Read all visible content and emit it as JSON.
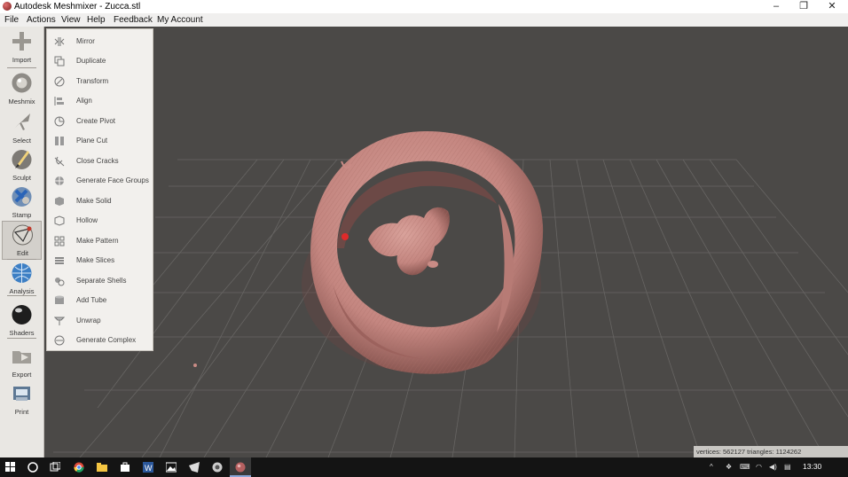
{
  "window": {
    "title": "Autodesk Meshmixer - Zucca.stl",
    "minimize_glyph": "–",
    "restore_glyph": "❐",
    "close_glyph": "✕"
  },
  "menubar": [
    "File",
    "Actions",
    "View",
    "Help",
    "Feedback",
    "My Account"
  ],
  "toolbar": [
    {
      "label": "Import",
      "icon": "plus-icon"
    },
    {
      "label": "Meshmix",
      "icon": "meshmix-sphere-icon"
    },
    {
      "label": "Select",
      "icon": "arrow-cursor-icon"
    },
    {
      "label": "Sculpt",
      "icon": "brush-icon"
    },
    {
      "label": "Stamp",
      "icon": "stamp-icon"
    },
    {
      "label": "Edit",
      "icon": "edit-sphere-icon",
      "active": true
    },
    {
      "label": "Analysis",
      "icon": "analysis-globe-icon"
    },
    {
      "label": "Shaders",
      "icon": "shader-ball-icon"
    },
    {
      "label": "Export",
      "icon": "export-folder-icon"
    },
    {
      "label": "Print",
      "icon": "printer-icon"
    }
  ],
  "edit_menu": [
    {
      "label": "Mirror",
      "icon": "mirror-icon"
    },
    {
      "label": "Duplicate",
      "icon": "duplicate-icon"
    },
    {
      "label": "Transform",
      "icon": "transform-icon"
    },
    {
      "label": "Align",
      "icon": "align-icon"
    },
    {
      "label": "Create Pivot",
      "icon": "pivot-icon"
    },
    {
      "label": "Plane Cut",
      "icon": "plane-cut-icon"
    },
    {
      "label": "Close Cracks",
      "icon": "close-cracks-icon"
    },
    {
      "label": "Generate Face Groups",
      "icon": "face-groups-icon"
    },
    {
      "label": "Make Solid",
      "icon": "make-solid-icon"
    },
    {
      "label": "Hollow",
      "icon": "hollow-icon"
    },
    {
      "label": "Make Pattern",
      "icon": "pattern-icon"
    },
    {
      "label": "Make Slices",
      "icon": "slices-icon"
    },
    {
      "label": "Separate Shells",
      "icon": "shells-icon"
    },
    {
      "label": "Add Tube",
      "icon": "tube-icon"
    },
    {
      "label": "Unwrap",
      "icon": "unwrap-icon"
    },
    {
      "label": "Generate Complex",
      "icon": "complex-icon"
    }
  ],
  "status": {
    "mesh_stats": "vertices: 562127 triangles: 1124262"
  },
  "taskbar": {
    "time": "13:30",
    "apps": [
      "start-icon",
      "cortana-icon",
      "task-view-icon",
      "chrome-icon",
      "file-explorer-icon",
      "store-icon",
      "word-icon",
      "photos-icon",
      "app-icon",
      "browser-icon",
      "meshmixer-icon"
    ]
  },
  "colors": {
    "viewport_bg": "#4b4947",
    "grid": "#6a6866",
    "mesh": "#c98b85",
    "mesh_shadow": "#7e4d49",
    "pivot_marker": "#e02a2a"
  }
}
